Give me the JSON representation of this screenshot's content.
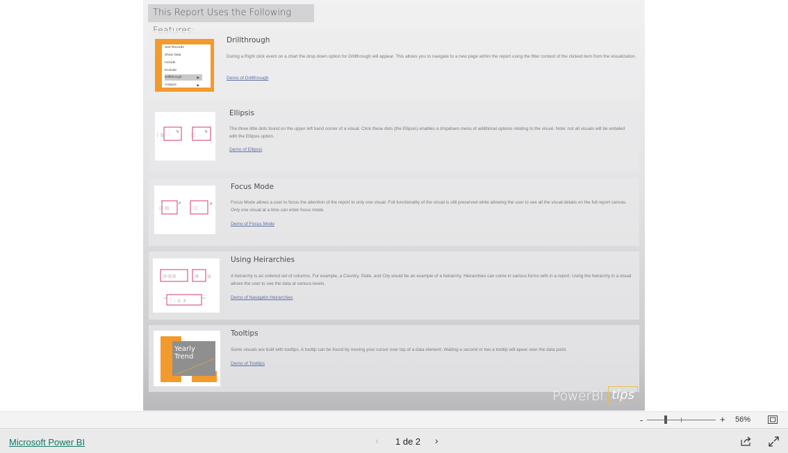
{
  "report": {
    "header": "This Report Uses the Following Features:",
    "features": [
      {
        "title": "Drillthrough",
        "description": "During a Right click event on a chart the drop down option for Drillthrough will appear. This allows you to navigate to a new page within the report using the filter context of the clicked item from the visualization.",
        "link": "Demo of Drillthrough",
        "menu_items": [
          "See Records",
          "Show Data",
          "Include",
          "Exclude",
          "Drillthrough",
          "Analyze"
        ]
      },
      {
        "title": "Ellipsis",
        "description": "The three little dots found on the upper left hand corner of a visual. Click these dots (the Ellipsis) enables a dropdown menu of additional options relating to the visual. Note: not all visuals will be enbaled with the Ellipsis option.",
        "link": "Demo of Ellipsis"
      },
      {
        "title": "Focus Mode",
        "description": "Focus Mode allows a user to focus the attention of the report to only one visual. Full functionality of the visual is still preserved while allowing the user to see all the visual details on the full report canvas. Only one visual at a time can enter focus mode.",
        "link": "Demo of Focus Mode"
      },
      {
        "title": "Using Heirarchies",
        "description": "A heirarchy is an ordered set of columns. For example, a Country, State, and City would be an example of a heirarchy. Hierarchies can come in various forms with in a report. Using the heirarchy in a visual allows the user to see the data at various levels.",
        "link": "Demo of Navigatin Heirarchies"
      },
      {
        "title": "Tooltips",
        "description": "Some visuals are built with tooltips. A tooltip can be found by moving your cursor over top of a data element. Waiting a second or two a tooltip will apear over the data point.",
        "link": "Demo of Tooltips",
        "tooltip_thumb_text": "Yearly Trend"
      }
    ],
    "watermark": {
      "brand": "PowerBI.",
      "suffix": "tips"
    }
  },
  "zoom": {
    "minus": "-",
    "plus": "+",
    "level": "56%",
    "fraction": 0.27
  },
  "footer": {
    "brand_link": "Microsoft Power BI",
    "page_info": "1 de 2",
    "prev_icon": "‹",
    "next_icon": "›"
  },
  "colors": {
    "accent_orange": "#f39a2c",
    "highlight_pink": "#d2386e",
    "link_blue": "#5b6fa6",
    "brand_green": "#117865",
    "watermark_gold": "#e9c04b"
  }
}
